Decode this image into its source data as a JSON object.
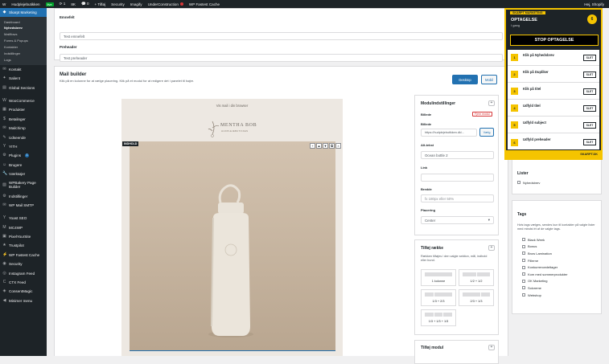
{
  "adminbar": {
    "wp": "W",
    "site": "Hudplejebutikken",
    "live": "live",
    "updates": "1",
    "wc_count": "8K",
    "comments": "0",
    "new": "+ Tilføj",
    "items": [
      "Security",
      "Imagify",
      "UnderConstruction",
      "WP Fastest Cache"
    ],
    "user": "Hej, Shopify"
  },
  "sidebar": {
    "top_item": "Skarpt Marketing",
    "submenu": [
      "Dashboard",
      "Nyhedsbrev",
      "Mailflows",
      "Forms & Popups",
      "Kontakter",
      "Indstillinger",
      "Logs"
    ],
    "items": [
      {
        "icon": "✉",
        "label": "Kontakt"
      },
      {
        "icon": "✦",
        "label": "Salient"
      },
      {
        "icon": "▤",
        "label": "Global Sections"
      },
      {
        "icon": "W",
        "label": "WooCommerce"
      },
      {
        "icon": "▦",
        "label": "Produkter"
      },
      {
        "icon": "$",
        "label": "Betalinger"
      },
      {
        "icon": "✉",
        "label": "Mailchimp"
      },
      {
        "icon": "✎",
        "label": "Udseende"
      },
      {
        "icon": "Y",
        "label": "YITH"
      },
      {
        "icon": "⚙",
        "label": "Plugins",
        "badge": "1"
      },
      {
        "icon": "☺",
        "label": "Brugere"
      },
      {
        "icon": "🔧",
        "label": "Værktøjer"
      },
      {
        "icon": "▧",
        "label": "WPBakery Page Builder"
      },
      {
        "icon": "⚙",
        "label": "Indstillinger"
      },
      {
        "icon": "✉",
        "label": "WP Mail SMTP"
      },
      {
        "icon": "Y",
        "label": "Yoast SEO"
      },
      {
        "icon": "M",
        "label": "MC4WP"
      },
      {
        "icon": "▣",
        "label": "PixelYourSite"
      },
      {
        "icon": "★",
        "label": "Trustpilot"
      },
      {
        "icon": "⚡",
        "label": "WP Fastest Cache"
      },
      {
        "icon": "◉",
        "label": "Security"
      },
      {
        "icon": "◎",
        "label": "Instagram Feed"
      },
      {
        "icon": "C",
        "label": "CTX Feed"
      },
      {
        "icon": "◈",
        "label": "ConsentMagic"
      },
      {
        "icon": "◀",
        "label": "Minimer menu"
      }
    ]
  },
  "fields": {
    "subject_label": "Emnefelt",
    "subject_value": "Test emnefelt",
    "preheader_label": "Preheader",
    "preheader_value": "Test preheader"
  },
  "builder": {
    "title": "Mail builder",
    "subtitle": "Klik på en kolonne for at vælge placering. Klik på et modul for at redigere det i panelet til højre.",
    "desktop": "Desktop",
    "mobile": "Mobil",
    "browser_link": "Vis mail i din browser",
    "brand_name": "MENTHA BOB",
    "brand_sub": "HUDPLEJEBUTIKKEN",
    "block_tag": "INDHOLD",
    "tools": [
      "+",
      "▲",
      "▼",
      "⧉",
      "×"
    ]
  },
  "module_settings": {
    "title": "Modulindstillinger",
    "image_label": "Billede",
    "remove_module": "Fjern modul",
    "image_section": "Billede",
    "image_url": "https://hudplejebutikken.dk/...",
    "choose": "Vælg",
    "alt_label": "Alt-tekst",
    "alt_value": "Ocean bottle 2",
    "link_label": "Link",
    "link_value": "",
    "width_label": "Bredde",
    "width_placeholder": "fx 180px eller 50%",
    "placement_label": "Placering",
    "placement_value": "Center"
  },
  "add_row": {
    "title": "Tilføj række",
    "desc": "Rækken tilføjes i den valgte sektion, mål, indhold eller bund.",
    "layouts": [
      "1 kolonne",
      "1/2 + 1/2",
      "1/3 + 2/3",
      "2/3 + 1/3",
      "1/3 + 1/3 + 1/3"
    ]
  },
  "add_module": {
    "title": "Tilføj modul"
  },
  "lists": {
    "title": "Lister",
    "items": [
      "Nyhedsbrev"
    ]
  },
  "tags": {
    "title": "Tags",
    "desc": "Hvis tags vælges, sendes kun til kontakter på valgte lister med mindst ét af de valgte tags.",
    "items": [
      "Black Week",
      "Bonus",
      "Brow Lamination",
      "Fillerne",
      "Konkurrencedeltager",
      "Kom med sommerprodukter",
      "OK Marketing",
      "Solcreme",
      "Webshop"
    ]
  },
  "guide": {
    "header": "SKARPT MARKETING",
    "title": "OPTAGELSE",
    "subtitle": "I gang",
    "count": "6",
    "stop": "STOP OPTAGELSE",
    "steps": [
      {
        "n": "1",
        "text": "Klik på Nyhedsbrev",
        "btn": "SLET"
      },
      {
        "n": "2",
        "text": "Klik på Dupliker",
        "btn": "SLET"
      },
      {
        "n": "3",
        "text": "Klik på titel",
        "btn": "SLET"
      },
      {
        "n": "4",
        "text": "Udfyld titel",
        "btn": "SLET"
      },
      {
        "n": "5",
        "text": "Udfyld subject",
        "btn": "SLET"
      },
      {
        "n": "6",
        "text": "Udfyld preheader",
        "btn": "SLET"
      }
    ],
    "footer": "SKARPT.DK"
  },
  "colors": {
    "accent": "#2271b1",
    "guide": "#f5c400",
    "admin": "#1d2327"
  }
}
